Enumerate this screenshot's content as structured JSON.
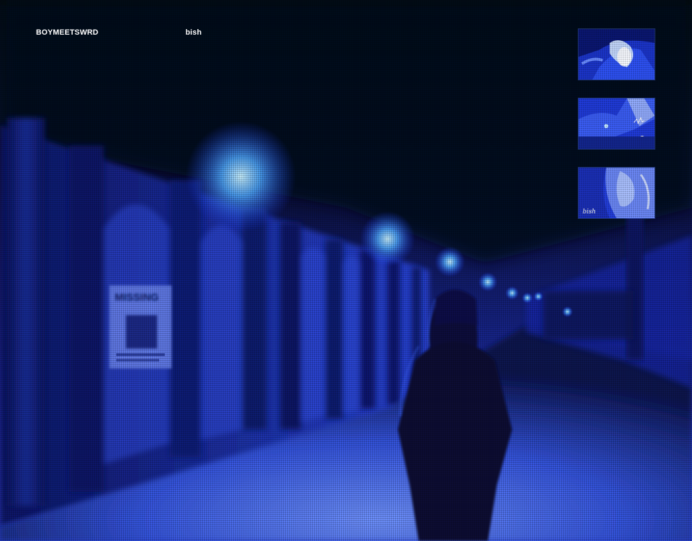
{
  "header": {
    "brand": "BOYMEETSWRD",
    "title": "bish"
  },
  "poster": {
    "heading": "MISSING"
  },
  "thumbnails": [
    {
      "name": "thumbnail-hand"
    },
    {
      "name": "thumbnail-scribble",
      "caption": ""
    },
    {
      "name": "thumbnail-signature",
      "caption": "bish"
    }
  ],
  "colors": {
    "background": "#06081a",
    "accent": "#2a5cff",
    "glow": "#8fd0ff",
    "text": "#ffffff"
  }
}
